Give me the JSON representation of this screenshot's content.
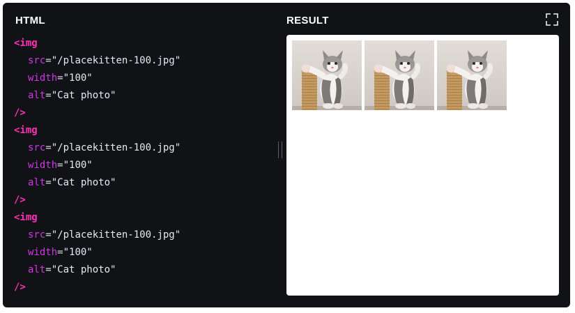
{
  "editor": {
    "heading": "HTML"
  },
  "result": {
    "heading": "RESULT",
    "images": [
      {
        "alt": "Cat photo",
        "width": 100
      },
      {
        "alt": "Cat photo",
        "width": 100
      },
      {
        "alt": "Cat photo",
        "width": 100
      }
    ]
  },
  "toolbar": {
    "fullscreen_icon": "fullscreen-icon"
  },
  "code": {
    "blocks": [
      {
        "open": "<img",
        "attrs": [
          {
            "name": "src",
            "eq": "=",
            "value": "\"/placekitten-100.jpg\""
          },
          {
            "name": "width",
            "eq": "=",
            "value": "\"100\""
          },
          {
            "name": "alt",
            "eq": "=",
            "value": "\"Cat photo\""
          }
        ],
        "close": "/>"
      },
      {
        "open": "<img",
        "attrs": [
          {
            "name": "src",
            "eq": "=",
            "value": "\"/placekitten-100.jpg\""
          },
          {
            "name": "width",
            "eq": "=",
            "value": "\"100\""
          },
          {
            "name": "alt",
            "eq": "=",
            "value": "\"Cat photo\""
          }
        ],
        "close": "/>"
      },
      {
        "open": "<img",
        "attrs": [
          {
            "name": "src",
            "eq": "=",
            "value": "\"/placekitten-100.jpg\""
          },
          {
            "name": "width",
            "eq": "=",
            "value": "\"100\""
          },
          {
            "name": "alt",
            "eq": "=",
            "value": "\"Cat photo\""
          }
        ],
        "close": "/>"
      }
    ]
  },
  "colors": {
    "panel_bg": "#111215",
    "tag": "#ff2eb5",
    "attribute": "#cf36e6",
    "string": "#e9e7f0"
  }
}
